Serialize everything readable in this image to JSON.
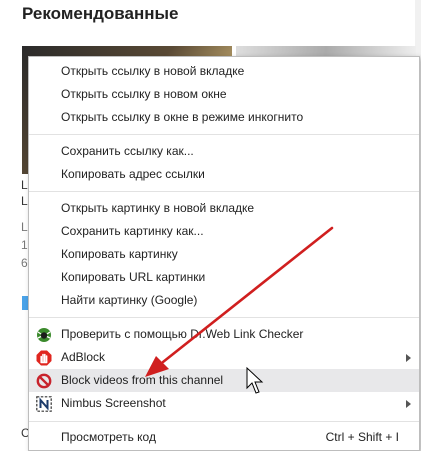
{
  "page": {
    "title": "Рекомендованные"
  },
  "background": {
    "side_chars": [
      "L",
      "L",
      "L",
      "1",
      "6",
      "C"
    ]
  },
  "context_menu": {
    "items": [
      {
        "label": "Открыть ссылку в новой вкладке"
      },
      {
        "label": "Открыть ссылку в новом окне"
      },
      {
        "label": "Открыть ссылку в окне в режиме инкогнито"
      },
      {
        "label": "Сохранить ссылку как..."
      },
      {
        "label": "Копировать адрес ссылки"
      },
      {
        "label": "Открыть картинку в новой вкладке"
      },
      {
        "label": "Сохранить картинку как..."
      },
      {
        "label": "Копировать картинку"
      },
      {
        "label": "Копировать URL картинки"
      },
      {
        "label": "Найти картинку (Google)"
      },
      {
        "label": "Проверить с помощью Dr.Web Link Checker",
        "icon": "drweb-spider-icon"
      },
      {
        "label": "AdBlock",
        "icon": "adblock-hand-icon"
      },
      {
        "label": "Block videos from this channel",
        "icon": "block-circle-icon"
      },
      {
        "label": "Nimbus Screenshot",
        "icon": "nimbus-n-icon"
      },
      {
        "label": "Просмотреть код",
        "shortcut": "Ctrl + Shift + I"
      }
    ]
  },
  "colors": {
    "arrow": "#d01f1f",
    "hover_row": "#e8e8ea",
    "adblock": "#e0261f",
    "block": "#c8232c",
    "drweb": "#3b8a2c"
  }
}
